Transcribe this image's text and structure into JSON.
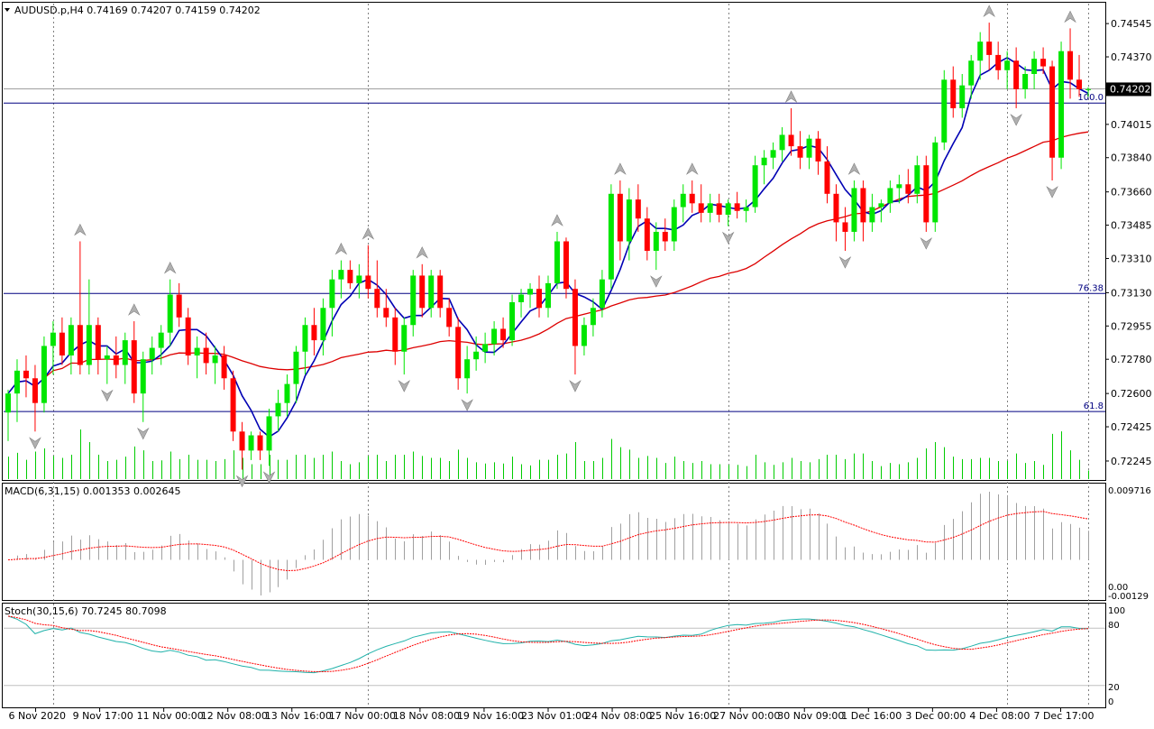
{
  "main_panel": {
    "header": "AUDUSD.p,H4  0.74169 0.74207 0.74159 0.74202",
    "price_labels": [
      "0.74545",
      "0.74370",
      "0.74015",
      "0.73840",
      "0.73660",
      "0.73485",
      "0.73310",
      "0.73130",
      "0.72955",
      "0.72780",
      "0.72600",
      "0.72425",
      "0.72245"
    ],
    "current_price_label": "0.74202",
    "fib_levels": [
      {
        "label": "100.0",
        "price": 0.74127
      },
      {
        "label": "76.38",
        "price": 0.73126
      },
      {
        "label": "61.8",
        "price": 0.72505
      }
    ],
    "bid_line_price": 0.74202
  },
  "macd_panel": {
    "header": "MACD(6,31,15) 0.001353 0.002645",
    "scale_labels": [
      "0.009716",
      "0.00",
      "-0.00129"
    ]
  },
  "stoch_panel": {
    "header": "Stoch(30,15,6) 70.7245 80.7098",
    "scale_labels": [
      "100",
      "80",
      "20",
      "0"
    ]
  },
  "time_labels": [
    "6 Nov 2020",
    "9 Nov 17:00",
    "11 Nov 00:00",
    "12 Nov 08:00",
    "13 Nov 16:00",
    "17 Nov 00:00",
    "18 Nov 08:00",
    "19 Nov 16:00",
    "23 Nov 01:00",
    "24 Nov 08:00",
    "25 Nov 16:00",
    "27 Nov 00:00",
    "30 Nov 09:00",
    "1 Dec 16:00",
    "3 Dec 00:00",
    "4 Dec 08:00",
    "7 Dec 17:00"
  ],
  "colors": {
    "bull": "#00e600",
    "bear": "#ff0000",
    "fast_ma": "#0000b4",
    "slow_ma": "#dd0000",
    "grid": "#808080",
    "volume": "#00cc00",
    "macd_hist": "#a0a0a0",
    "macd_signal": "#ff0000",
    "stoch_main": "#20b2aa",
    "stoch_signal": "#ff0000",
    "fib": "#000080"
  },
  "chart_data": {
    "type": "candlestick",
    "symbol": "AUDUSD.p",
    "timeframe": "H4",
    "ylim": [
      0.7215,
      0.7465
    ],
    "candles": [
      [
        0.725,
        0.7262,
        0.7235,
        0.726
      ],
      [
        0.726,
        0.7278,
        0.7245,
        0.7272
      ],
      [
        0.7272,
        0.728,
        0.7258,
        0.7268
      ],
      [
        0.7268,
        0.7275,
        0.724,
        0.7255
      ],
      [
        0.7255,
        0.729,
        0.725,
        0.7285
      ],
      [
        0.7285,
        0.7298,
        0.727,
        0.7292
      ],
      [
        0.7292,
        0.73,
        0.7275,
        0.728
      ],
      [
        0.728,
        0.73,
        0.727,
        0.7296
      ],
      [
        0.7296,
        0.734,
        0.727,
        0.7275
      ],
      [
        0.7275,
        0.732,
        0.727,
        0.7296
      ],
      [
        0.7296,
        0.73,
        0.727,
        0.7278
      ],
      [
        0.7278,
        0.7285,
        0.7265,
        0.728
      ],
      [
        0.728,
        0.729,
        0.7268,
        0.7275
      ],
      [
        0.7275,
        0.7292,
        0.7265,
        0.7288
      ],
      [
        0.7288,
        0.7298,
        0.7255,
        0.726
      ],
      [
        0.726,
        0.7282,
        0.7245,
        0.7278
      ],
      [
        0.7278,
        0.729,
        0.727,
        0.7284
      ],
      [
        0.7284,
        0.7296,
        0.7275,
        0.7292
      ],
      [
        0.7292,
        0.732,
        0.7285,
        0.7312
      ],
      [
        0.7312,
        0.7318,
        0.7295,
        0.73
      ],
      [
        0.73,
        0.7305,
        0.7275,
        0.728
      ],
      [
        0.728,
        0.729,
        0.7268,
        0.7284
      ],
      [
        0.7284,
        0.7292,
        0.727,
        0.7276
      ],
      [
        0.7276,
        0.7285,
        0.7265,
        0.728
      ],
      [
        0.728,
        0.7285,
        0.7262,
        0.7268
      ],
      [
        0.7268,
        0.7272,
        0.7235,
        0.724
      ],
      [
        0.724,
        0.7245,
        0.722,
        0.723
      ],
      [
        0.723,
        0.724,
        0.7225,
        0.7238
      ],
      [
        0.7238,
        0.724,
        0.7225,
        0.723
      ],
      [
        0.723,
        0.7252,
        0.7222,
        0.7248
      ],
      [
        0.7248,
        0.7262,
        0.724,
        0.7255
      ],
      [
        0.7255,
        0.727,
        0.7248,
        0.7265
      ],
      [
        0.7265,
        0.7285,
        0.7255,
        0.7282
      ],
      [
        0.7282,
        0.73,
        0.727,
        0.7296
      ],
      [
        0.7296,
        0.7305,
        0.728,
        0.7288
      ],
      [
        0.7288,
        0.731,
        0.728,
        0.7305
      ],
      [
        0.7305,
        0.7325,
        0.729,
        0.732
      ],
      [
        0.732,
        0.733,
        0.731,
        0.7325
      ],
      [
        0.7325,
        0.733,
        0.7315,
        0.7318
      ],
      [
        0.7318,
        0.7328,
        0.731,
        0.7322
      ],
      [
        0.7322,
        0.7338,
        0.731,
        0.7315
      ],
      [
        0.7315,
        0.733,
        0.73,
        0.7305
      ],
      [
        0.7305,
        0.7315,
        0.7295,
        0.73
      ],
      [
        0.73,
        0.7305,
        0.7275,
        0.7282
      ],
      [
        0.7282,
        0.73,
        0.727,
        0.7296
      ],
      [
        0.7296,
        0.7325,
        0.729,
        0.7322
      ],
      [
        0.7322,
        0.7328,
        0.73,
        0.7305
      ],
      [
        0.7305,
        0.7325,
        0.73,
        0.7322
      ],
      [
        0.7322,
        0.7325,
        0.73,
        0.7305
      ],
      [
        0.7305,
        0.731,
        0.729,
        0.7295
      ],
      [
        0.7295,
        0.73,
        0.7262,
        0.7268
      ],
      [
        0.7268,
        0.7285,
        0.726,
        0.7278
      ],
      [
        0.7278,
        0.729,
        0.7272,
        0.7282
      ],
      [
        0.7282,
        0.7292,
        0.7276,
        0.7286
      ],
      [
        0.7286,
        0.7298,
        0.728,
        0.7294
      ],
      [
        0.7294,
        0.73,
        0.7284,
        0.7288
      ],
      [
        0.7288,
        0.7312,
        0.7285,
        0.7308
      ],
      [
        0.7308,
        0.7315,
        0.73,
        0.7312
      ],
      [
        0.7312,
        0.7318,
        0.7305,
        0.7315
      ],
      [
        0.7315,
        0.7322,
        0.73,
        0.7305
      ],
      [
        0.7305,
        0.7322,
        0.73,
        0.7318
      ],
      [
        0.7318,
        0.7345,
        0.7315,
        0.734
      ],
      [
        0.734,
        0.7342,
        0.731,
        0.7315
      ],
      [
        0.7315,
        0.732,
        0.727,
        0.7285
      ],
      [
        0.7285,
        0.73,
        0.728,
        0.7296
      ],
      [
        0.7296,
        0.731,
        0.729,
        0.7305
      ],
      [
        0.7305,
        0.7325,
        0.73,
        0.732
      ],
      [
        0.732,
        0.737,
        0.7315,
        0.7365
      ],
      [
        0.7365,
        0.7372,
        0.733,
        0.734
      ],
      [
        0.734,
        0.7368,
        0.733,
        0.7362
      ],
      [
        0.7362,
        0.737,
        0.7345,
        0.7352
      ],
      [
        0.7352,
        0.7358,
        0.733,
        0.7335
      ],
      [
        0.7335,
        0.735,
        0.7325,
        0.7345
      ],
      [
        0.7345,
        0.7352,
        0.7335,
        0.734
      ],
      [
        0.734,
        0.7362,
        0.7335,
        0.7358
      ],
      [
        0.7358,
        0.737,
        0.735,
        0.7365
      ],
      [
        0.7365,
        0.7372,
        0.7355,
        0.736
      ],
      [
        0.736,
        0.737,
        0.735,
        0.7355
      ],
      [
        0.7355,
        0.7365,
        0.735,
        0.736
      ],
      [
        0.736,
        0.7365,
        0.735,
        0.7354
      ],
      [
        0.7354,
        0.7362,
        0.7348,
        0.736
      ],
      [
        0.736,
        0.7366,
        0.7352,
        0.7356
      ],
      [
        0.7356,
        0.7362,
        0.735,
        0.7358
      ],
      [
        0.7358,
        0.7385,
        0.7355,
        0.738
      ],
      [
        0.738,
        0.7388,
        0.737,
        0.7384
      ],
      [
        0.7384,
        0.7392,
        0.7378,
        0.7388
      ],
      [
        0.7388,
        0.74,
        0.7382,
        0.7396
      ],
      [
        0.7396,
        0.741,
        0.7385,
        0.739
      ],
      [
        0.739,
        0.7398,
        0.7378,
        0.7384
      ],
      [
        0.7384,
        0.7396,
        0.7378,
        0.7394
      ],
      [
        0.7394,
        0.7398,
        0.7375,
        0.7382
      ],
      [
        0.7382,
        0.739,
        0.736,
        0.7365
      ],
      [
        0.7365,
        0.737,
        0.734,
        0.735
      ],
      [
        0.735,
        0.7358,
        0.7335,
        0.7345
      ],
      [
        0.7345,
        0.7372,
        0.734,
        0.7368
      ],
      [
        0.7368,
        0.7372,
        0.734,
        0.735
      ],
      [
        0.735,
        0.7365,
        0.7345,
        0.7358
      ],
      [
        0.7358,
        0.7362,
        0.735,
        0.736
      ],
      [
        0.736,
        0.7372,
        0.7355,
        0.7368
      ],
      [
        0.7368,
        0.7375,
        0.736,
        0.737
      ],
      [
        0.737,
        0.7378,
        0.736,
        0.7365
      ],
      [
        0.7365,
        0.7385,
        0.736,
        0.738
      ],
      [
        0.738,
        0.7385,
        0.7345,
        0.735
      ],
      [
        0.735,
        0.7395,
        0.7345,
        0.7392
      ],
      [
        0.7392,
        0.743,
        0.7388,
        0.7425
      ],
      [
        0.7425,
        0.7432,
        0.7405,
        0.741
      ],
      [
        0.741,
        0.7428,
        0.7405,
        0.7422
      ],
      [
        0.7422,
        0.7438,
        0.7415,
        0.7435
      ],
      [
        0.7435,
        0.745,
        0.7425,
        0.7445
      ],
      [
        0.7445,
        0.7455,
        0.743,
        0.7438
      ],
      [
        0.7438,
        0.7445,
        0.7425,
        0.743
      ],
      [
        0.743,
        0.744,
        0.742,
        0.7435
      ],
      [
        0.7435,
        0.7442,
        0.741,
        0.742
      ],
      [
        0.742,
        0.7432,
        0.7415,
        0.7428
      ],
      [
        0.7428,
        0.744,
        0.742,
        0.7436
      ],
      [
        0.7436,
        0.7442,
        0.7428,
        0.7432
      ],
      [
        0.7432,
        0.7435,
        0.7372,
        0.7384
      ],
      [
        0.7384,
        0.7445,
        0.7378,
        0.744
      ],
      [
        0.744,
        0.7452,
        0.7415,
        0.7425
      ],
      [
        0.7425,
        0.7438,
        0.7416,
        0.742
      ],
      [
        0.742,
        0.7421,
        0.7416,
        0.742
      ]
    ]
  }
}
